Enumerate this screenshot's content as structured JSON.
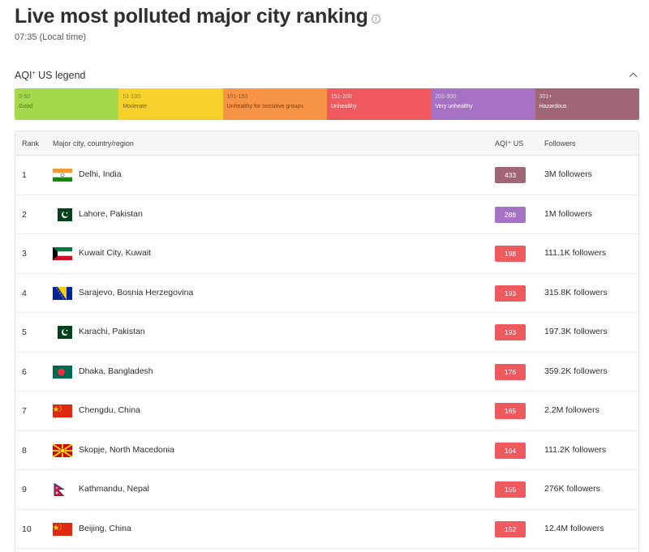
{
  "header": {
    "title": "Live most polluted major city ranking",
    "info_icon": "i",
    "local_time": "07:35 (Local time)"
  },
  "legend": {
    "title": "AQI",
    "title_sup": "+",
    "title_suffix": " US legend",
    "segments": [
      {
        "range": "0-50",
        "label": "Good",
        "color": "#a3d94b",
        "text_color": "#4a6a1a"
      },
      {
        "range": "51-100",
        "label": "Moderate",
        "color": "#f6d12c",
        "text_color": "#7a6210"
      },
      {
        "range": "101-150",
        "label": "Unhealthy for sensitive groups",
        "color": "#f79446",
        "text_color": "#7a3c0e"
      },
      {
        "range": "151-200",
        "label": "Unhealthy",
        "color": "#ef5a5e",
        "text_color": "#ffffff"
      },
      {
        "range": "201-300",
        "label": "Very unhealthy",
        "color": "#a572c4",
        "text_color": "#ffffff"
      },
      {
        "range": "301+",
        "label": "Hazardous",
        "color": "#a16674",
        "text_color": "#ffffff"
      }
    ]
  },
  "table": {
    "headers": {
      "rank": "Rank",
      "city": "Major city, country/region",
      "aqi": "AQI⁺ US",
      "followers": "Followers"
    },
    "rows": [
      {
        "rank": "1",
        "city": "Delhi, India",
        "flag": "india",
        "aqi": "433",
        "aqi_color": "#a16674",
        "followers": "3M followers"
      },
      {
        "rank": "2",
        "city": "Lahore, Pakistan",
        "flag": "pakistan",
        "aqi": "288",
        "aqi_color": "#a572c4",
        "followers": "1M followers"
      },
      {
        "rank": "3",
        "city": "Kuwait City, Kuwait",
        "flag": "kuwait",
        "aqi": "198",
        "aqi_color": "#ef5a5e",
        "followers": "111.1K followers"
      },
      {
        "rank": "4",
        "city": "Sarajevo, Bosnia Herzegovina",
        "flag": "bosnia",
        "aqi": "193",
        "aqi_color": "#ef5a5e",
        "followers": "315.8K followers"
      },
      {
        "rank": "5",
        "city": "Karachi, Pakistan",
        "flag": "pakistan",
        "aqi": "193",
        "aqi_color": "#ef5a5e",
        "followers": "197.3K followers"
      },
      {
        "rank": "6",
        "city": "Dhaka, Bangladesh",
        "flag": "bangladesh",
        "aqi": "176",
        "aqi_color": "#ef5a5e",
        "followers": "359.2K followers"
      },
      {
        "rank": "7",
        "city": "Chengdu, China",
        "flag": "china",
        "aqi": "165",
        "aqi_color": "#ef5a5e",
        "followers": "2.2M followers"
      },
      {
        "rank": "8",
        "city": "Skopje, North Macedonia",
        "flag": "north-macedonia",
        "aqi": "164",
        "aqi_color": "#ef5a5e",
        "followers": "111.2K followers"
      },
      {
        "rank": "9",
        "city": "Kathmandu, Nepal",
        "flag": "nepal",
        "aqi": "155",
        "aqi_color": "#ef5a5e",
        "followers": "276K followers"
      },
      {
        "rank": "10",
        "city": "Beijing, China",
        "flag": "china",
        "aqi": "152",
        "aqi_color": "#ef5a5e",
        "followers": "12.4M followers"
      }
    ]
  }
}
